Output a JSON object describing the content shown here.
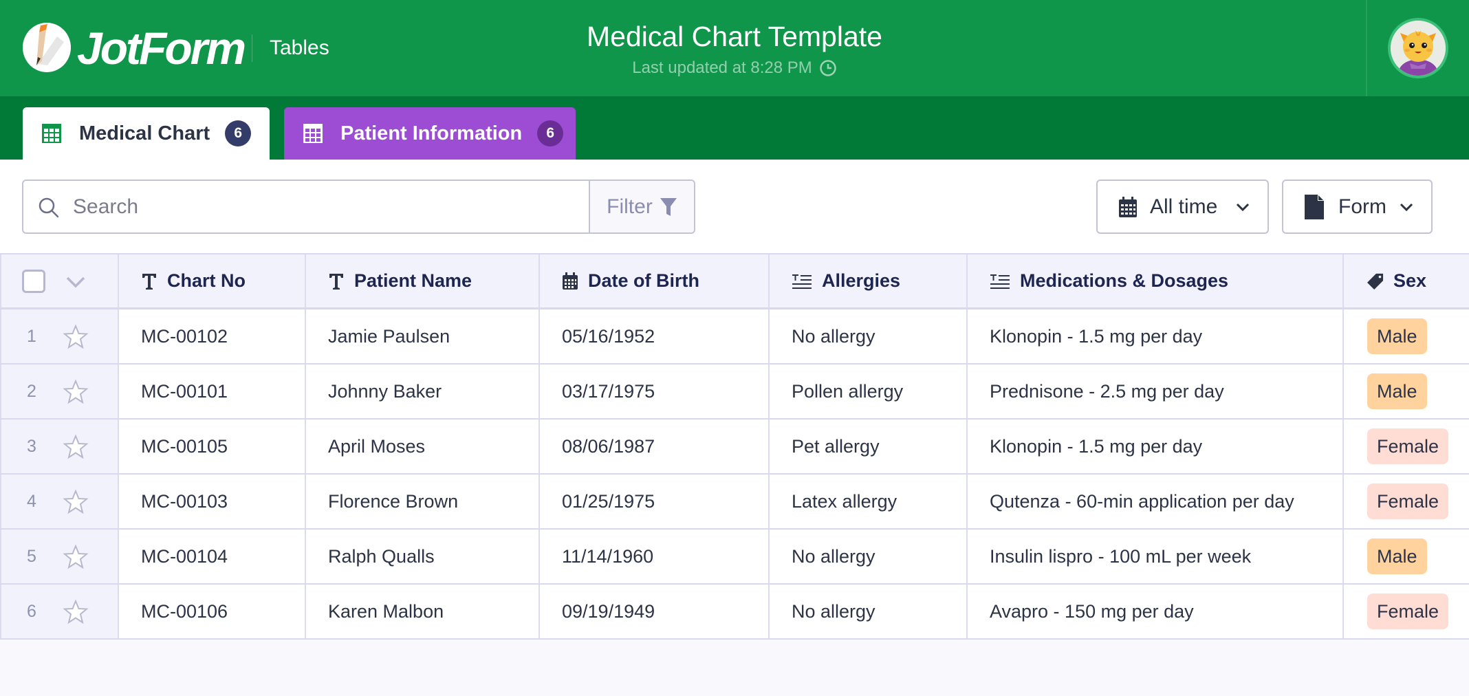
{
  "header": {
    "brand": "JotForm",
    "product": "Tables",
    "title": "Medical Chart Template",
    "last_updated": "Last updated at 8:28 PM",
    "accent_color": "#0f964a"
  },
  "tabs": [
    {
      "label": "Medical Chart",
      "count": "6",
      "active": true,
      "icon": "table-grid-icon"
    },
    {
      "label": "Patient Information",
      "count": "6",
      "active": false,
      "icon": "table-grid-icon",
      "color": "#9c4dd3"
    }
  ],
  "toolbar": {
    "search_placeholder": "Search",
    "search_value": "",
    "filter_label": "Filter",
    "date_range": "All time",
    "source": "Form"
  },
  "table": {
    "columns": [
      {
        "label": "Chart No",
        "icon": "text-type-icon"
      },
      {
        "label": "Patient Name",
        "icon": "text-type-icon"
      },
      {
        "label": "Date of Birth",
        "icon": "calendar-icon"
      },
      {
        "label": "Allergies",
        "icon": "long-text-icon"
      },
      {
        "label": "Medications & Dosages",
        "icon": "long-text-icon"
      },
      {
        "label": "Sex",
        "icon": "tag-icon"
      }
    ],
    "rows": [
      {
        "num": "1",
        "chart_no": "MC-00102",
        "name": "Jamie Paulsen",
        "dob": "05/16/1952",
        "allergies": "No allergy",
        "medications": "Klonopin - 1.5 mg per day",
        "sex": "Male"
      },
      {
        "num": "2",
        "chart_no": "MC-00101",
        "name": "Johnny Baker",
        "dob": "03/17/1975",
        "allergies": "Pollen allergy",
        "medications": "Prednisone - 2.5 mg per day",
        "sex": "Male"
      },
      {
        "num": "3",
        "chart_no": "MC-00105",
        "name": "April Moses",
        "dob": "08/06/1987",
        "allergies": "Pet allergy",
        "medications": "Klonopin - 1.5 mg per day",
        "sex": "Female"
      },
      {
        "num": "4",
        "chart_no": "MC-00103",
        "name": "Florence Brown",
        "dob": "01/25/1975",
        "allergies": "Latex allergy",
        "medications": "Qutenza - 60-min application per day",
        "sex": "Female"
      },
      {
        "num": "5",
        "chart_no": "MC-00104",
        "name": "Ralph Qualls",
        "dob": "11/14/1960",
        "allergies": "No allergy",
        "medications": "Insulin lispro - 100 mL per week",
        "sex": "Male"
      },
      {
        "num": "6",
        "chart_no": "MC-00106",
        "name": "Karen Malbon",
        "dob": "09/19/1949",
        "allergies": "No allergy",
        "medications": "Avapro - 150 mg per day",
        "sex": "Female"
      }
    ],
    "badge_colors": {
      "Male": "#ffd29e",
      "Female": "#ffdcd4"
    }
  }
}
